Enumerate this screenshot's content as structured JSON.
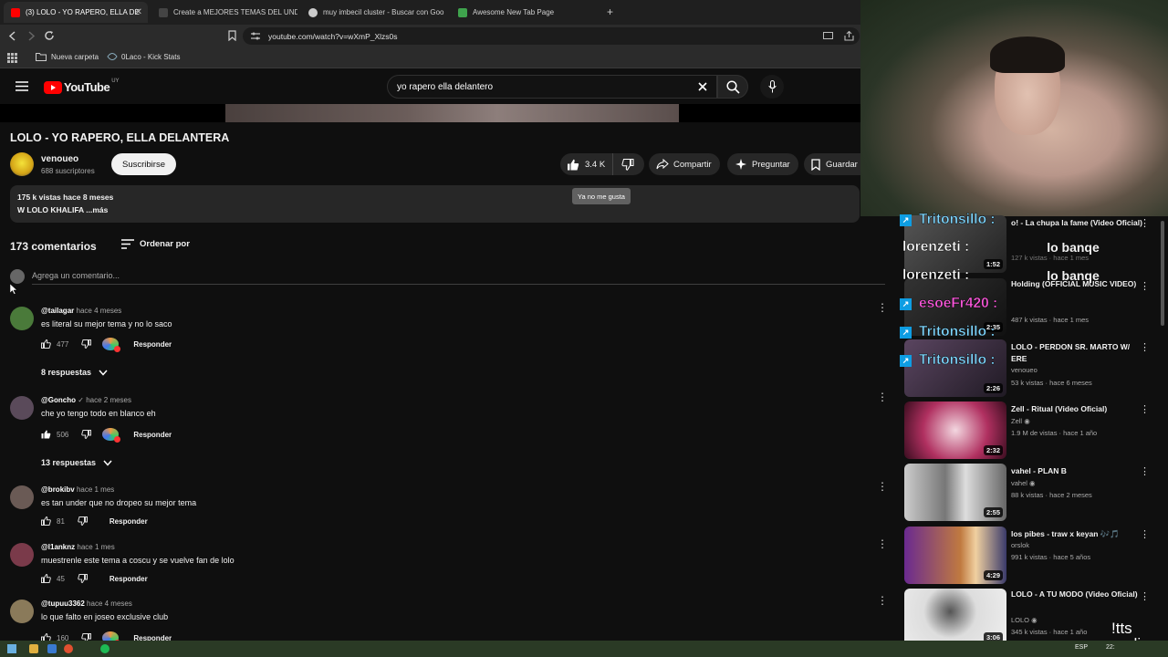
{
  "browser": {
    "tabs": [
      {
        "title": "(3) LOLO - YO RAPERO, ELLA DE",
        "active": true,
        "icon_color": "#ff0000"
      },
      {
        "title": "Create a MEJORES TEMAS DEL UNDE",
        "active": false,
        "icon_color": "#444444"
      },
      {
        "title": "muy imbecil cluster - Buscar con Goo",
        "active": false,
        "icon_color": "#cccccc"
      },
      {
        "title": "Awesome New Tab Page",
        "active": false,
        "icon_color": "#3fa34d"
      }
    ],
    "new_tab": "+",
    "close_tab": "✕",
    "url": "youtube.com/watch?v=wXmP_Xlzs0s",
    "bookmarks": [
      "Nueva carpeta",
      "0Laco - Kick Stats"
    ]
  },
  "youtube": {
    "logo_text": "YouTube",
    "region": "UY",
    "search_query": "yo rapero ella delantero",
    "video_title": "LOLO - YO RAPERO, ELLA DELANTERA",
    "channel": {
      "name": "venoueo",
      "subs": "688 suscriptores",
      "subscribe": "Suscribirse"
    },
    "actions": {
      "likes": "3.4 K",
      "share": "Compartir",
      "ask": "Preguntar",
      "save": "Guardar"
    },
    "tooltip": "Ya no me gusta",
    "description": {
      "line1": "175 k vistas  hace 8 meses",
      "line2": "W LOLO KHALIFA  ...más"
    },
    "comments_header": {
      "count": "173 comentarios",
      "sort": "Ordenar por",
      "placeholder": "Agrega un comentario..."
    },
    "comments": [
      {
        "author": "@tailagar",
        "time": "hace 4 meses",
        "text": "es literal su mejor tema y no lo saco",
        "likes": "477",
        "reply": "Responder",
        "replies": "8 respuestas",
        "avatar": "#4a7a3a"
      },
      {
        "author": "@Goncho",
        "verified": "✓",
        "time": "hace 2 meses",
        "text": "che yo tengo todo en blanco eh",
        "likes": "506",
        "reply": "Responder",
        "replies": "13 respuestas",
        "avatar": "#5a4a5a"
      },
      {
        "author": "@brokibv",
        "time": "hace 1 mes",
        "text": "es tan under que no dropeo su mejor tema",
        "likes": "81",
        "reply": "Responder",
        "avatar": "#6a5a55"
      },
      {
        "author": "@l1anknz",
        "time": "hace 1 mes",
        "text": "muestrenle este tema a coscu y se vuelve fan de lolo",
        "likes": "45",
        "reply": "Responder",
        "avatar": "#7a3a4a"
      },
      {
        "author": "@tupuu3362",
        "time": "hace 4 meses",
        "text": "lo que falto en joseo exclusive club",
        "likes": "160",
        "reply": "Responder",
        "avatar": "#8a7a5a"
      }
    ]
  },
  "sidebar": {
    "recs": [
      {
        "title": "o! - La chupa la fame (Video Oficial)",
        "channel": "",
        "meta": "127 k vistas · hace 1 mes",
        "duration": "1:52",
        "thumb": "#3a3a3a"
      },
      {
        "title": "Holding (OFFICIAL MUSIC VIDEO)",
        "channel": "",
        "meta": "487 k vistas · hace 1 mes",
        "duration": "2:35",
        "thumb": "#2a2a2a"
      },
      {
        "title": "LOLO - PERDON SR. MARTO W/ ERE",
        "channel": "venoueo",
        "meta": "53 k vistas · hace 6 meses",
        "duration": "2:26",
        "thumb": "#3b3040"
      },
      {
        "title": "Zell - Ritual (Video Oficial)",
        "channel": "Zell",
        "meta": "1.9 M de vistas · hace 1 año",
        "duration": "2:32",
        "thumb": "#b03060"
      },
      {
        "title": "vahel - PLAN B",
        "channel": "vahel",
        "meta": "88 k vistas · hace 2 meses",
        "duration": "2:55",
        "thumb": "#7a7a7a"
      },
      {
        "title": "los pibes - traw x keyan 🎶🎵",
        "channel": "orslok",
        "meta": "991 k vistas · hace 5 años",
        "duration": "4:29",
        "thumb": "#7a3aa0"
      },
      {
        "title": "LOLO - A TU MODO (Video Oficial)",
        "channel": "LOLO",
        "meta": "345 k vistas · hace 1 año",
        "duration": "3:06",
        "thumb": "#dadada"
      }
    ],
    "chat": [
      {
        "name": "Tritonsillo :",
        "msg": "",
        "color": "#7fd7ff"
      },
      {
        "name": "lorenzeti :",
        "msg": "lo banqe",
        "color": "#ffffff"
      },
      {
        "name": "lorenzeti :",
        "msg": "lo banqe",
        "color": "#ffffff"
      },
      {
        "name": "esoeFr420 :",
        "msg": "",
        "color": "#ff5adf"
      },
      {
        "name": "Tritonsillo :",
        "msg": "",
        "color": "#7fd7ff"
      },
      {
        "name": "Tritonsillo :",
        "msg": "",
        "color": "#7fd7ff"
      }
    ]
  },
  "overlay": {
    "watermark": "!tts\naudios"
  },
  "taskbar": {
    "lang": "ESP",
    "clock": "22:"
  }
}
